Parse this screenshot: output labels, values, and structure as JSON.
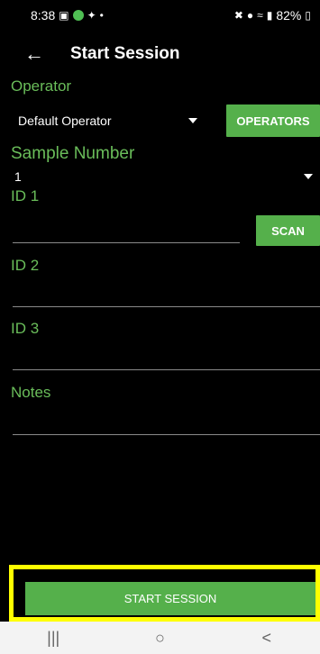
{
  "status_bar": {
    "time": "8:38",
    "battery": "82%"
  },
  "app_bar": {
    "title": "Start Session"
  },
  "form": {
    "operator": {
      "label": "Operator",
      "value": "Default Operator",
      "button": "OPERATORS"
    },
    "sample_number": {
      "label": "Sample Number",
      "value": "1"
    },
    "id1": {
      "label": "ID 1",
      "value": "",
      "button": "SCAN"
    },
    "id2": {
      "label": "ID 2",
      "value": ""
    },
    "id3": {
      "label": "ID 3",
      "value": ""
    },
    "notes": {
      "label": "Notes",
      "value": ""
    }
  },
  "footer": {
    "start_button": "START SESSION"
  },
  "nav_bar": {
    "recent": "|||",
    "home": "○",
    "back": "<"
  },
  "colors": {
    "accent": "#55b04b",
    "label_green": "#6abd5a",
    "highlight": "#ffff00"
  }
}
